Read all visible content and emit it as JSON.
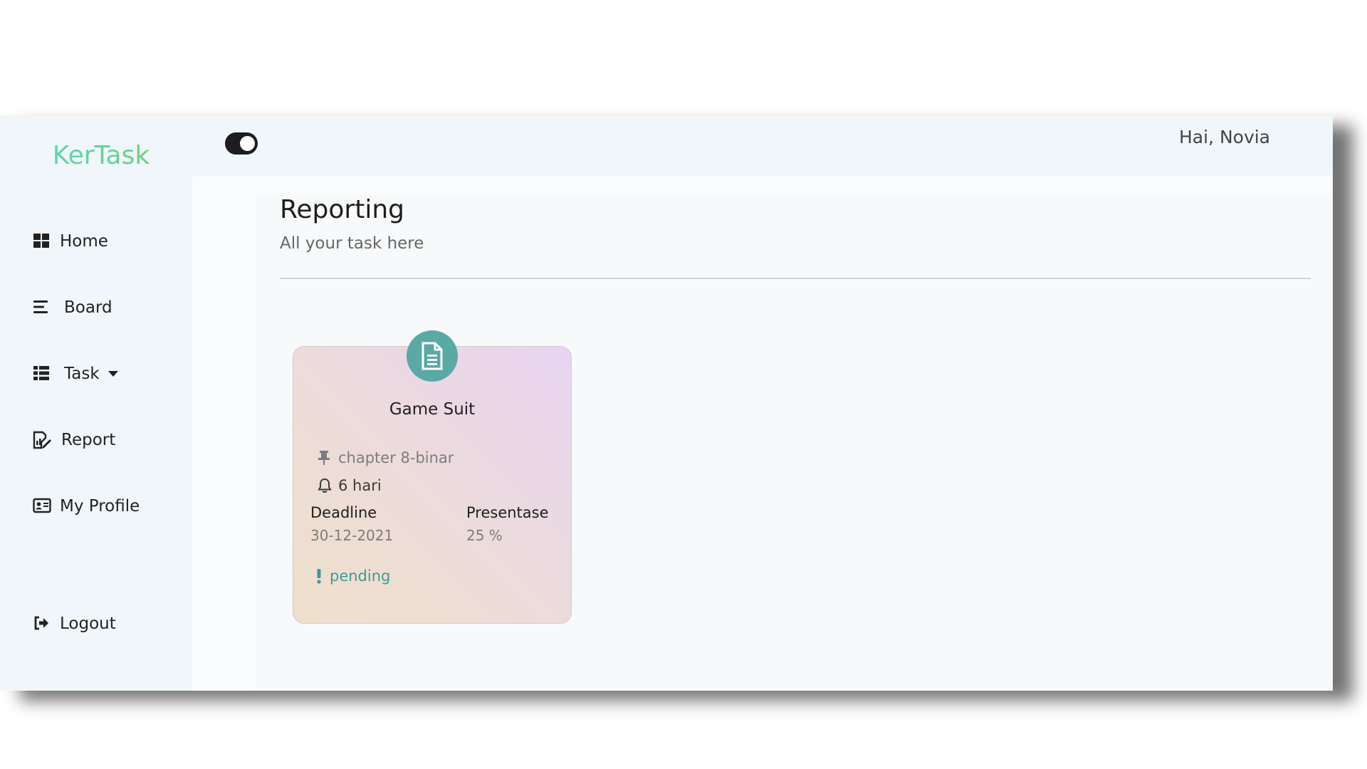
{
  "app": {
    "brand": "KerTask"
  },
  "sidebar": {
    "items": [
      {
        "label": "Home",
        "icon": "grid-icon"
      },
      {
        "label": "Board",
        "icon": "bars-icon"
      },
      {
        "label": "Task",
        "icon": "list-icon"
      },
      {
        "label": "Report",
        "icon": "report-icon"
      },
      {
        "label": "My Profile",
        "icon": "id-card-icon"
      }
    ],
    "logout": {
      "label": "Logout",
      "icon": "logout-icon"
    }
  },
  "header": {
    "greeting": "Hai, Novia",
    "theme_toggle": "toggle-icon"
  },
  "main": {
    "title": "Reporting",
    "subtitle": "All your task here"
  },
  "card": {
    "icon": "document-icon",
    "title": "Game Suit",
    "category": "chapter 8-binar",
    "days_left": "6 hari",
    "deadline_label": "Deadline",
    "deadline_value": "30-12-2021",
    "percentage_label": "Presentase",
    "percentage_value": "25 %",
    "status": "pending"
  },
  "colors": {
    "accent": "#5aa9a5",
    "brand_start": "#5fd8c2",
    "brand_end": "#6acf6a",
    "status": "#3c9c93"
  }
}
